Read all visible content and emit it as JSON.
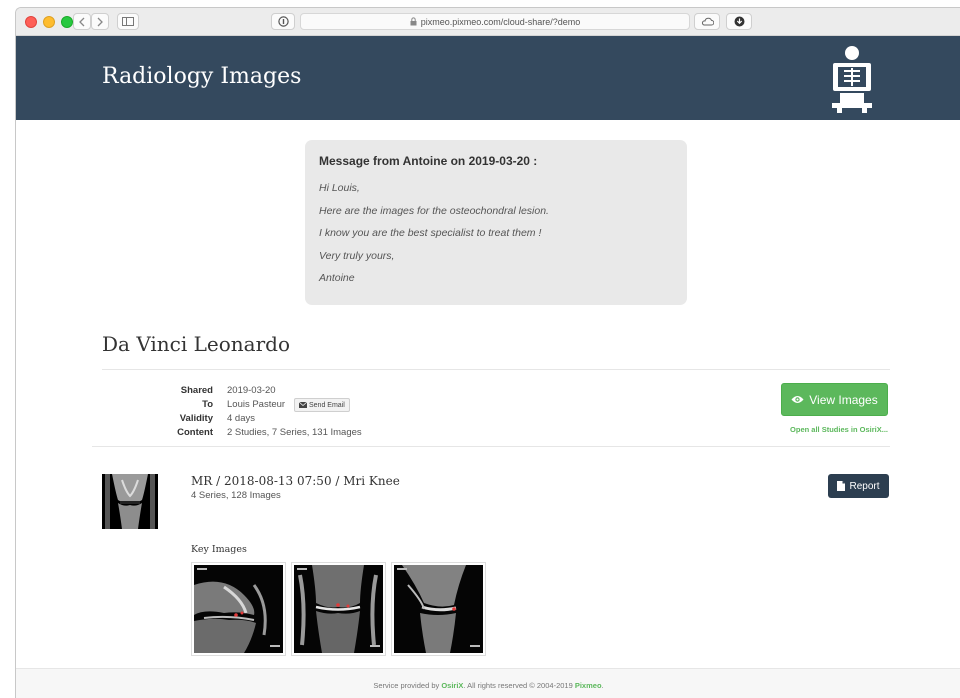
{
  "browser": {
    "url": "pixmeo.pixmeo.com/cloud-share/?demo"
  },
  "header": {
    "title": "Radiology Images",
    "logo_icon": "xray-person-icon"
  },
  "message": {
    "header": "Message from Antoine on 2019-03-20 :",
    "lines": [
      "Hi Louis,",
      "Here are the images for the osteochondral lesion.",
      "I know you are the best specialist to treat them !",
      "Very truly yours,",
      "Antoine"
    ]
  },
  "patient": {
    "name": "Da Vinci Leonardo",
    "info": {
      "shared_label": "Shared",
      "shared_value": "2019-03-20",
      "to_label": "To",
      "to_value": "Louis Pasteur",
      "send_email_label": "Send Email",
      "validity_label": "Validity",
      "validity_value": "4 days",
      "content_label": "Content",
      "content_value": "2 Studies, 7 Series, 131 Images"
    },
    "view_images_label": "View Images",
    "open_osirix_label": "Open all Studies in OsiriX..."
  },
  "study": {
    "title": "MR / 2018-08-13 07:50 / Mri Knee",
    "subtitle": "4 Series, 128 Images",
    "report_label": "Report",
    "key_images_title": "Key Images"
  },
  "footer": {
    "prefix": "Service provided by",
    "osirix": "OsiriX",
    "middle": ". All rights reserved © 2004-2019",
    "pixmeo": "Pixmeo",
    "suffix": "."
  },
  "colors": {
    "header_bg": "#34495e",
    "success": "#5cb85c",
    "report_bg": "#2c3e50",
    "message_bg": "#e9e9e9"
  }
}
